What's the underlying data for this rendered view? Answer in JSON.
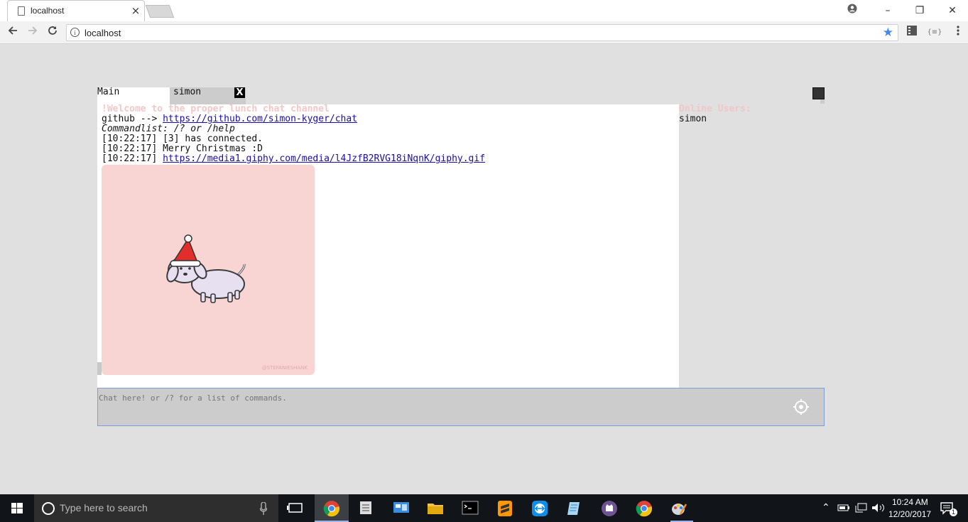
{
  "browser": {
    "tab_title": "localhost",
    "tab_close": "×",
    "address": "localhost",
    "window_buttons": {
      "minimize": "–",
      "maximize": "❐",
      "close": "✕"
    },
    "icons": [
      "back-icon",
      "forward-icon",
      "reload-icon",
      "info-icon",
      "star-icon",
      "extensions-icon",
      "menu-icon",
      "account-icon"
    ]
  },
  "app": {
    "tabs": [
      {
        "label": "Main"
      },
      {
        "label": "simon"
      }
    ],
    "tab_close": "X",
    "messages": {
      "welcome": "!Welcome to the proper lunch chat channel",
      "github_prefix": "github --> ",
      "github_link": "https://github.com/simon-kyger/chat",
      "commandlist": "Commandlist: /? or /help",
      "msg1": "[10:22:17] [3] has connected.",
      "msg2": "[10:22:17] Merry Christmas :D",
      "msg3_time": "[10:22:17] ",
      "msg3_link": "https://media1.giphy.com/media/l4JzfB2RVG18iNqnK/giphy.gif",
      "gif_credit": "@STEFANIESHANK"
    },
    "online": {
      "title": "Online Users:",
      "users": [
        "simon"
      ]
    },
    "input": {
      "placeholder": "Chat here! or /? for a list of commands."
    }
  },
  "taskbar": {
    "search_placeholder": "Type here to search",
    "time": "10:24 AM",
    "date": "12/20/2017",
    "notification_count": "1"
  },
  "colors": {
    "page_bg": "#e0e0e0",
    "welcome_text": "#f4c7c7",
    "gif_bg": "#f8d5d3",
    "link": "#1a0dab",
    "input_border": "#7b9fd8"
  }
}
